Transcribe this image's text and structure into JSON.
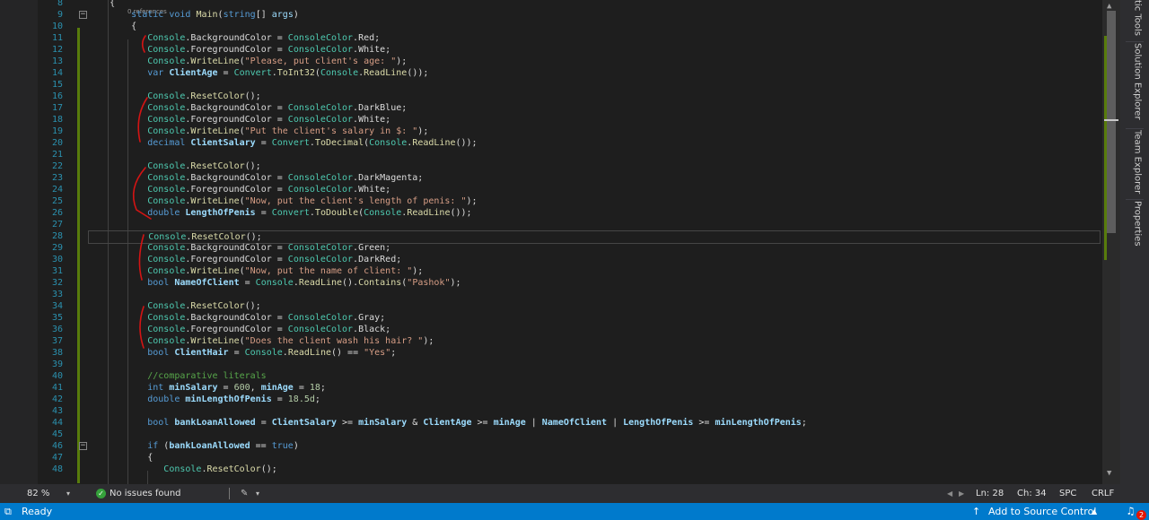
{
  "editor": {
    "codelens": "0 references",
    "lines": [
      {
        "n": "8",
        "tokens": [
          {
            "t": "    {"
          }
        ]
      },
      {
        "n": "9",
        "tokens": [
          {
            "t": "        "
          },
          {
            "t": "static",
            "c": "kw"
          },
          {
            "t": " "
          },
          {
            "t": "void",
            "c": "kw"
          },
          {
            "t": " "
          },
          {
            "t": "Main",
            "c": "me"
          },
          {
            "t": "("
          },
          {
            "t": "string",
            "c": "kw"
          },
          {
            "t": "[] "
          },
          {
            "t": "args",
            "c": "pm"
          },
          {
            "t": ")"
          }
        ]
      },
      {
        "n": "10",
        "tokens": [
          {
            "t": "        {"
          }
        ]
      },
      {
        "n": "11",
        "tokens": [
          {
            "t": "           "
          },
          {
            "t": "Console",
            "c": "ty"
          },
          {
            "t": "."
          },
          {
            "t": "BackgroundColor"
          },
          {
            "t": " = "
          },
          {
            "t": "ConsoleColor",
            "c": "ty"
          },
          {
            "t": ".Red;"
          }
        ]
      },
      {
        "n": "12",
        "tokens": [
          {
            "t": "           "
          },
          {
            "t": "Console",
            "c": "ty"
          },
          {
            "t": "."
          },
          {
            "t": "ForegroundColor"
          },
          {
            "t": " = "
          },
          {
            "t": "ConsoleColor",
            "c": "ty"
          },
          {
            "t": ".White;"
          }
        ]
      },
      {
        "n": "13",
        "tokens": [
          {
            "t": "           "
          },
          {
            "t": "Console",
            "c": "ty"
          },
          {
            "t": "."
          },
          {
            "t": "WriteLine",
            "c": "me"
          },
          {
            "t": "("
          },
          {
            "t": "\"Please, put client's age: \"",
            "c": "st"
          },
          {
            "t": ");"
          }
        ]
      },
      {
        "n": "14",
        "tokens": [
          {
            "t": "           "
          },
          {
            "t": "var",
            "c": "kw"
          },
          {
            "t": " "
          },
          {
            "t": "ClientAge",
            "c": "lv"
          },
          {
            "t": " = "
          },
          {
            "t": "Convert",
            "c": "ty"
          },
          {
            "t": "."
          },
          {
            "t": "ToInt32",
            "c": "me"
          },
          {
            "t": "("
          },
          {
            "t": "Console",
            "c": "ty"
          },
          {
            "t": "."
          },
          {
            "t": "ReadLine",
            "c": "me"
          },
          {
            "t": "());"
          }
        ]
      },
      {
        "n": "15",
        "tokens": []
      },
      {
        "n": "16",
        "tokens": [
          {
            "t": "           "
          },
          {
            "t": "Console",
            "c": "ty"
          },
          {
            "t": "."
          },
          {
            "t": "ResetColor",
            "c": "me"
          },
          {
            "t": "();"
          }
        ]
      },
      {
        "n": "17",
        "tokens": [
          {
            "t": "           "
          },
          {
            "t": "Console",
            "c": "ty"
          },
          {
            "t": "."
          },
          {
            "t": "BackgroundColor"
          },
          {
            "t": " = "
          },
          {
            "t": "ConsoleColor",
            "c": "ty"
          },
          {
            "t": ".DarkBlue;"
          }
        ]
      },
      {
        "n": "18",
        "tokens": [
          {
            "t": "           "
          },
          {
            "t": "Console",
            "c": "ty"
          },
          {
            "t": "."
          },
          {
            "t": "ForegroundColor"
          },
          {
            "t": " = "
          },
          {
            "t": "ConsoleColor",
            "c": "ty"
          },
          {
            "t": ".White;"
          }
        ]
      },
      {
        "n": "19",
        "tokens": [
          {
            "t": "           "
          },
          {
            "t": "Console",
            "c": "ty"
          },
          {
            "t": "."
          },
          {
            "t": "WriteLine",
            "c": "me"
          },
          {
            "t": "("
          },
          {
            "t": "\"Put the client's salary in $: \"",
            "c": "st"
          },
          {
            "t": ");"
          }
        ]
      },
      {
        "n": "20",
        "tokens": [
          {
            "t": "           "
          },
          {
            "t": "decimal",
            "c": "kw"
          },
          {
            "t": " "
          },
          {
            "t": "ClientSalary",
            "c": "lv"
          },
          {
            "t": " = "
          },
          {
            "t": "Convert",
            "c": "ty"
          },
          {
            "t": "."
          },
          {
            "t": "ToDecimal",
            "c": "me"
          },
          {
            "t": "("
          },
          {
            "t": "Console",
            "c": "ty"
          },
          {
            "t": "."
          },
          {
            "t": "ReadLine",
            "c": "me"
          },
          {
            "t": "());"
          }
        ]
      },
      {
        "n": "21",
        "tokens": []
      },
      {
        "n": "22",
        "tokens": [
          {
            "t": "           "
          },
          {
            "t": "Console",
            "c": "ty"
          },
          {
            "t": "."
          },
          {
            "t": "ResetColor",
            "c": "me"
          },
          {
            "t": "();"
          }
        ]
      },
      {
        "n": "23",
        "tokens": [
          {
            "t": "           "
          },
          {
            "t": "Console",
            "c": "ty"
          },
          {
            "t": "."
          },
          {
            "t": "BackgroundColor"
          },
          {
            "t": " = "
          },
          {
            "t": "ConsoleColor",
            "c": "ty"
          },
          {
            "t": ".DarkMagenta;"
          }
        ]
      },
      {
        "n": "24",
        "tokens": [
          {
            "t": "           "
          },
          {
            "t": "Console",
            "c": "ty"
          },
          {
            "t": "."
          },
          {
            "t": "ForegroundColor"
          },
          {
            "t": " = "
          },
          {
            "t": "ConsoleColor",
            "c": "ty"
          },
          {
            "t": ".White;"
          }
        ]
      },
      {
        "n": "25",
        "tokens": [
          {
            "t": "           "
          },
          {
            "t": "Console",
            "c": "ty"
          },
          {
            "t": "."
          },
          {
            "t": "WriteLine",
            "c": "me"
          },
          {
            "t": "("
          },
          {
            "t": "\"Now, put the client's length of penis: \"",
            "c": "st"
          },
          {
            "t": ");"
          }
        ]
      },
      {
        "n": "26",
        "tokens": [
          {
            "t": "           "
          },
          {
            "t": "double",
            "c": "kw"
          },
          {
            "t": " "
          },
          {
            "t": "LengthOfPenis",
            "c": "lv"
          },
          {
            "t": " = "
          },
          {
            "t": "Convert",
            "c": "ty"
          },
          {
            "t": "."
          },
          {
            "t": "ToDouble",
            "c": "me"
          },
          {
            "t": "("
          },
          {
            "t": "Console",
            "c": "ty"
          },
          {
            "t": "."
          },
          {
            "t": "ReadLine",
            "c": "me"
          },
          {
            "t": "());"
          }
        ]
      },
      {
        "n": "27",
        "tokens": []
      },
      {
        "n": "28",
        "tokens": [
          {
            "t": "           "
          },
          {
            "t": "Console",
            "c": "ty"
          },
          {
            "t": "."
          },
          {
            "t": "ResetColor",
            "c": "me"
          },
          {
            "t": "();"
          }
        ],
        "current": true
      },
      {
        "n": "29",
        "tokens": [
          {
            "t": "           "
          },
          {
            "t": "Console",
            "c": "ty"
          },
          {
            "t": "."
          },
          {
            "t": "BackgroundColor"
          },
          {
            "t": " = "
          },
          {
            "t": "ConsoleColor",
            "c": "ty"
          },
          {
            "t": ".Green;"
          }
        ]
      },
      {
        "n": "30",
        "tokens": [
          {
            "t": "           "
          },
          {
            "t": "Console",
            "c": "ty"
          },
          {
            "t": "."
          },
          {
            "t": "ForegroundColor"
          },
          {
            "t": " = "
          },
          {
            "t": "ConsoleColor",
            "c": "ty"
          },
          {
            "t": ".DarkRed;"
          }
        ]
      },
      {
        "n": "31",
        "tokens": [
          {
            "t": "           "
          },
          {
            "t": "Console",
            "c": "ty"
          },
          {
            "t": "."
          },
          {
            "t": "WriteLine",
            "c": "me"
          },
          {
            "t": "("
          },
          {
            "t": "\"Now, put the name of client: \"",
            "c": "st"
          },
          {
            "t": ");"
          }
        ]
      },
      {
        "n": "32",
        "tokens": [
          {
            "t": "           "
          },
          {
            "t": "bool",
            "c": "kw"
          },
          {
            "t": " "
          },
          {
            "t": "NameOfClient",
            "c": "lv"
          },
          {
            "t": " = "
          },
          {
            "t": "Console",
            "c": "ty"
          },
          {
            "t": "."
          },
          {
            "t": "ReadLine",
            "c": "me"
          },
          {
            "t": "()."
          },
          {
            "t": "Contains",
            "c": "me"
          },
          {
            "t": "("
          },
          {
            "t": "\"Pashok\"",
            "c": "st"
          },
          {
            "t": ");"
          }
        ]
      },
      {
        "n": "33",
        "tokens": []
      },
      {
        "n": "34",
        "tokens": [
          {
            "t": "           "
          },
          {
            "t": "Console",
            "c": "ty"
          },
          {
            "t": "."
          },
          {
            "t": "ResetColor",
            "c": "me"
          },
          {
            "t": "();"
          }
        ]
      },
      {
        "n": "35",
        "tokens": [
          {
            "t": "           "
          },
          {
            "t": "Console",
            "c": "ty"
          },
          {
            "t": "."
          },
          {
            "t": "BackgroundColor"
          },
          {
            "t": " = "
          },
          {
            "t": "ConsoleColor",
            "c": "ty"
          },
          {
            "t": ".Gray;"
          }
        ]
      },
      {
        "n": "36",
        "tokens": [
          {
            "t": "           "
          },
          {
            "t": "Console",
            "c": "ty"
          },
          {
            "t": "."
          },
          {
            "t": "ForegroundColor"
          },
          {
            "t": " = "
          },
          {
            "t": "ConsoleColor",
            "c": "ty"
          },
          {
            "t": ".Black;"
          }
        ]
      },
      {
        "n": "37",
        "tokens": [
          {
            "t": "           "
          },
          {
            "t": "Console",
            "c": "ty"
          },
          {
            "t": "."
          },
          {
            "t": "WriteLine",
            "c": "me"
          },
          {
            "t": "("
          },
          {
            "t": "\"Does the client wash his hair? \"",
            "c": "st"
          },
          {
            "t": ");"
          }
        ]
      },
      {
        "n": "38",
        "tokens": [
          {
            "t": "           "
          },
          {
            "t": "bool",
            "c": "kw"
          },
          {
            "t": " "
          },
          {
            "t": "ClientHair",
            "c": "lv"
          },
          {
            "t": " = "
          },
          {
            "t": "Console",
            "c": "ty"
          },
          {
            "t": "."
          },
          {
            "t": "ReadLine",
            "c": "me"
          },
          {
            "t": "() == "
          },
          {
            "t": "\"Yes\"",
            "c": "st"
          },
          {
            "t": ";"
          }
        ]
      },
      {
        "n": "39",
        "tokens": []
      },
      {
        "n": "40",
        "tokens": [
          {
            "t": "           "
          },
          {
            "t": "//comparative literals",
            "c": "cm"
          }
        ]
      },
      {
        "n": "41",
        "tokens": [
          {
            "t": "           "
          },
          {
            "t": "int",
            "c": "kw"
          },
          {
            "t": " "
          },
          {
            "t": "minSalary",
            "c": "lv"
          },
          {
            "t": " = "
          },
          {
            "t": "600",
            "c": "nu"
          },
          {
            "t": ", "
          },
          {
            "t": "minAge",
            "c": "lv"
          },
          {
            "t": " = "
          },
          {
            "t": "18",
            "c": "nu"
          },
          {
            "t": ";"
          }
        ]
      },
      {
        "n": "42",
        "tokens": [
          {
            "t": "           "
          },
          {
            "t": "double",
            "c": "kw"
          },
          {
            "t": " "
          },
          {
            "t": "minLengthOfPenis",
            "c": "lv"
          },
          {
            "t": " = "
          },
          {
            "t": "18.5d",
            "c": "nu"
          },
          {
            "t": ";"
          }
        ]
      },
      {
        "n": "43",
        "tokens": []
      },
      {
        "n": "44",
        "tokens": [
          {
            "t": "           "
          },
          {
            "t": "bool",
            "c": "kw"
          },
          {
            "t": " "
          },
          {
            "t": "bankLoanAllowed",
            "c": "lv"
          },
          {
            "t": " = "
          },
          {
            "t": "ClientSalary",
            "c": "lv"
          },
          {
            "t": " >= "
          },
          {
            "t": "minSalary",
            "c": "lv"
          },
          {
            "t": " & "
          },
          {
            "t": "ClientAge",
            "c": "lv"
          },
          {
            "t": " >= "
          },
          {
            "t": "minAge",
            "c": "lv"
          },
          {
            "t": " | "
          },
          {
            "t": "NameOfClient",
            "c": "lv"
          },
          {
            "t": " | "
          },
          {
            "t": "LengthOfPenis",
            "c": "lv"
          },
          {
            "t": " >= "
          },
          {
            "t": "minLengthOfPenis",
            "c": "lv"
          },
          {
            "t": ";"
          }
        ]
      },
      {
        "n": "45",
        "tokens": []
      },
      {
        "n": "46",
        "tokens": [
          {
            "t": "           "
          },
          {
            "t": "if",
            "c": "kw"
          },
          {
            "t": " ("
          },
          {
            "t": "bankLoanAllowed",
            "c": "lv"
          },
          {
            "t": " == "
          },
          {
            "t": "true",
            "c": "kw"
          },
          {
            "t": ")"
          }
        ]
      },
      {
        "n": "47",
        "tokens": [
          {
            "t": "           {"
          }
        ]
      },
      {
        "n": "48",
        "tokens": [
          {
            "t": "              "
          },
          {
            "t": "Console",
            "c": "ty"
          },
          {
            "t": "."
          },
          {
            "t": "ResetColor",
            "c": "me"
          },
          {
            "t": "();"
          }
        ]
      }
    ],
    "fold_lines": [
      "9",
      "46"
    ]
  },
  "side_tabs": {
    "diagnostic_tools": "tic Tools",
    "solution_explorer": "Solution Explorer",
    "team_explorer": "Team Explorer",
    "properties": "Properties"
  },
  "footer": {
    "zoom": "82 %",
    "zoom_caret": "▾",
    "issues": "No issues found",
    "line": "Ln: 28",
    "col": "Ch: 34",
    "indent": "SPC",
    "eol": "CRLF"
  },
  "statusbar": {
    "ready": "Ready",
    "source_control": "Add to Source Control",
    "notifications": "2"
  },
  "colors": {
    "editor_bg": "#1e1e1e",
    "status_bar": "#007acc",
    "change_bar": "#587c0c",
    "annotation_red": "#d41414"
  }
}
